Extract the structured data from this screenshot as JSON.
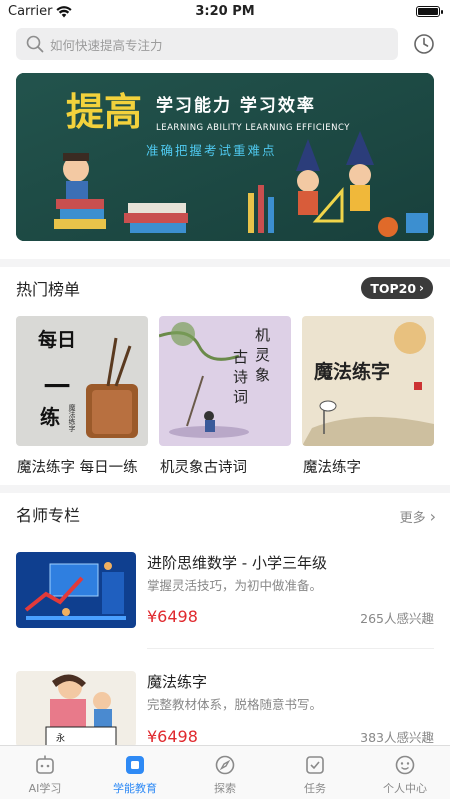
{
  "status": {
    "carrier": "Carrier",
    "time": "3:20 PM"
  },
  "search": {
    "placeholder": "如何快速提高专注力"
  },
  "banner": {
    "headline": "提高",
    "subtitle": "学习能力  学习效率",
    "english": "LEARNING ABILITY LEARNING EFFICIENCY",
    "tagline": "准确把握考试重难点"
  },
  "hot": {
    "title": "热门榜单",
    "badge": "TOP20",
    "items": [
      {
        "label": "魔法练字 每日一练",
        "art": "每日一练",
        "seal": "魔法练字"
      },
      {
        "label": "机灵象古诗词",
        "art": "机灵象古诗词"
      },
      {
        "label": "魔法练字",
        "art": "魔法练字"
      }
    ]
  },
  "teachers": {
    "title": "名师专栏",
    "more": "更多",
    "courses": [
      {
        "title": "进阶思维数学 - 小学三年级",
        "desc": "掌握灵活技巧，为初中做准备。",
        "price": "¥6498",
        "interest": "265人感兴趣"
      },
      {
        "title": "魔法练字",
        "desc": "完整教材体系，脱格随意书写。",
        "price": "¥6498",
        "interest": "383人感兴趣"
      }
    ]
  },
  "tabs": [
    {
      "label": "AI学习",
      "icon": "robot-icon",
      "active": false
    },
    {
      "label": "学能教育",
      "icon": "square-icon",
      "active": true
    },
    {
      "label": "探索",
      "icon": "compass-icon",
      "active": false
    },
    {
      "label": "任务",
      "icon": "task-check-icon",
      "active": false
    },
    {
      "label": "个人中心",
      "icon": "profile-face-icon",
      "active": false
    }
  ],
  "colors": {
    "accent": "#2f8af5",
    "price": "#e0292e",
    "banner_bg": "#1d4a45"
  }
}
